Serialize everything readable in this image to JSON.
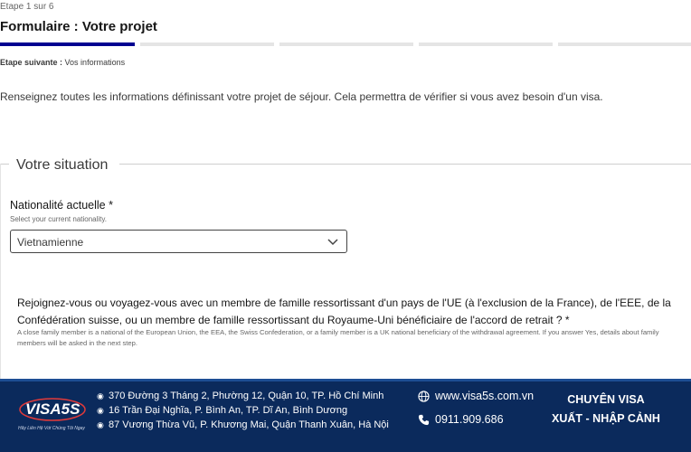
{
  "form": {
    "step": "Etape 1 sur 6",
    "title": "Formulaire : Votre projet",
    "next_label": "Etape suivante :",
    "next_value": "Vos informations",
    "intro": "Renseignez toutes les informations définissant votre projet de séjour. Cela permettra de vérifier si vous avez besoin d'un visa.",
    "progress": {
      "current_step": 1,
      "total_steps": 6
    }
  },
  "situation": {
    "legend": "Votre situation",
    "nationality_label": "Nationalité actuelle *",
    "nationality_hint": "Select your current nationality.",
    "nationality_value": "Vietnamienne",
    "question": "Rejoignez-vous ou voyagez-vous avec un membre de famille ressortissant d'un pays de l'UE (à l'exclusion de la France), de l'EEE, de la Confédération suisse, ou un membre de famille ressortissant du Royaume-Uni bénéficiaire de l'accord de retrait ? *",
    "question_hint": "A close family member is a national of the European Union, the EEA, the Swiss Confederation, or a family member is a UK national beneficiary of the withdrawal agreement. If you answer Yes, details about family members will be asked in the next step."
  },
  "footer": {
    "logo_text": "VISA5S",
    "logo_slogan": "Hãy Liên Hệ Với Chúng Tôi Ngay",
    "addresses": [
      "370 Đường 3 Tháng 2, Phường 12, Quận 10, TP. Hồ Chí Minh",
      "16 Trần Đại Nghĩa, P. Bình An, TP. Dĩ An, Bình Dương",
      "87 Vương Thừa Vũ, P. Khương Mai, Quận Thanh Xuân, Hà Nội"
    ],
    "website": "www.visa5s.com.vn",
    "phone": "0911.909.686",
    "tagline_1": "CHUYÊN VISA",
    "tagline_2": "XUẤT - NHẬP CẢNH"
  },
  "colors": {
    "accent": "#000091",
    "footer_bg": "#0b2a5c"
  }
}
